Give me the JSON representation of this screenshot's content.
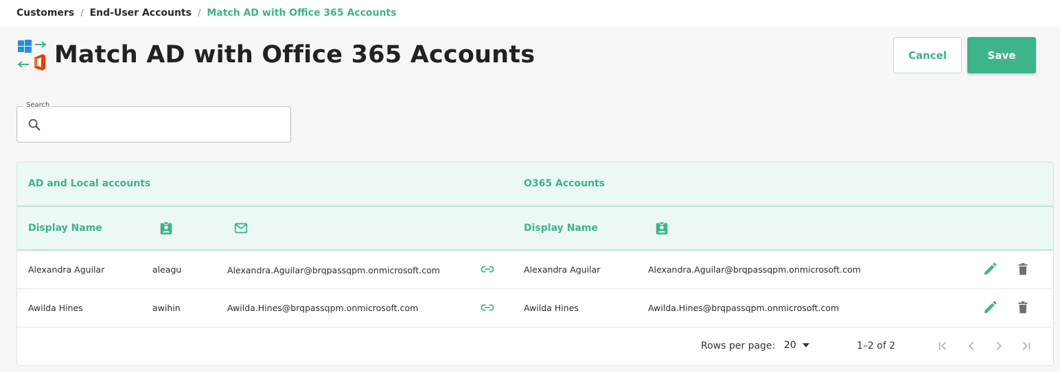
{
  "breadcrumb": {
    "items": [
      "Customers",
      "End-User Accounts",
      "Match AD with Office 365 Accounts"
    ],
    "separator": "/"
  },
  "header": {
    "title": "Match AD with Office 365 Accounts",
    "title_icon": "windows-office-sync-icon",
    "cancel_label": "Cancel",
    "save_label": "Save"
  },
  "search": {
    "legend": "Search",
    "value": "",
    "placeholder": "",
    "icon": "search-icon"
  },
  "table": {
    "groups": [
      "AD and Local accounts",
      "O365 Accounts"
    ],
    "ad_columns": {
      "display_name": "Display Name",
      "username_icon": "badge-icon",
      "email_icon": "envelope-icon"
    },
    "o365_columns": {
      "display_name": "Display Name",
      "username_icon": "badge-icon"
    },
    "rows": [
      {
        "ad_display_name": "Alexandra Aguilar",
        "ad_username": "aleagu",
        "ad_email": "Alexandra.Aguilar@brqpassqpm.onmicrosoft.com",
        "o365_display_name": "Alexandra Aguilar",
        "o365_username": "Alexandra.Aguilar@brqpassqpm.onmicrosoft.com"
      },
      {
        "ad_display_name": "Awilda Hines",
        "ad_username": "awihin",
        "ad_email": "Awilda.Hines@brqpassqpm.onmicrosoft.com",
        "o365_display_name": "Awilda Hines",
        "o365_username": "Awilda.Hines@brqpassqpm.onmicrosoft.com"
      }
    ],
    "row_icons": [
      "link-icon",
      "pencil-icon",
      "trash-icon"
    ]
  },
  "pagination": {
    "rows_per_page_label": "Rows per page:",
    "rows_per_page_value": "20",
    "range_text": "1–2 of 2"
  },
  "colors": {
    "accent": "#3eb489",
    "header_bg": "#ebf8f3",
    "background": "#f7f7f7"
  }
}
